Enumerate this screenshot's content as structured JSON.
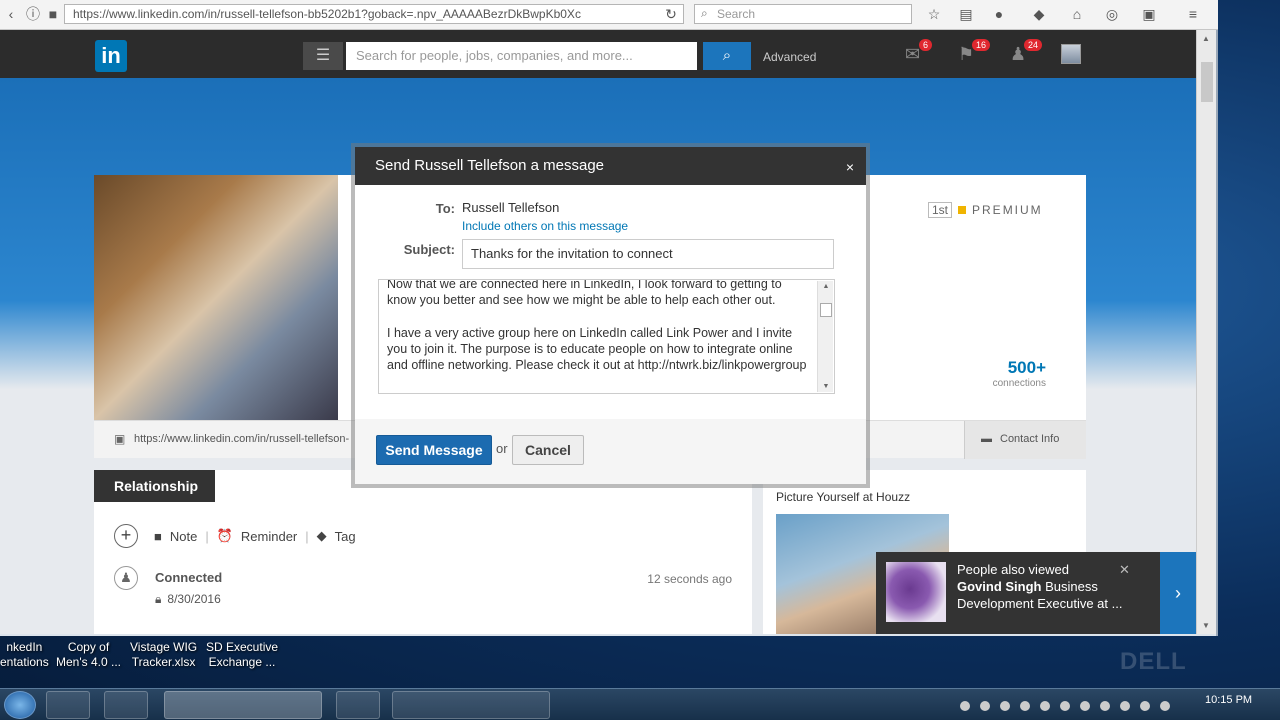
{
  "browser": {
    "url": "https://www.linkedin.com/in/russell-tellefson-bb5202b1?goback=.npv_AAAAABezrDkBwpKb0Xc",
    "search_placeholder": "Search"
  },
  "linkedin_header": {
    "logo": "in",
    "search_placeholder": "Search for people, jobs, companies, and more...",
    "advanced_label": "Advanced",
    "messages_count": "6",
    "notifications_count": "16",
    "add_connections_count": "24"
  },
  "profile": {
    "premium_degree": "1st",
    "premium_label": "PREMIUM",
    "connections_count": "500+",
    "connections_label": "connections",
    "public_url": "https://www.linkedin.com/in/russell-tellefson-",
    "contact_info_label": "Contact Info"
  },
  "relationship": {
    "tab_label": "Relationship",
    "note_label": "Note",
    "reminder_label": "Reminder",
    "tag_label": "Tag",
    "connected_label": "Connected",
    "connected_date": "8/30/2016",
    "connected_time": "12 seconds ago"
  },
  "ad": {
    "title": "Picture Yourself at Houzz"
  },
  "toast": {
    "header": "People also viewed",
    "name": "Govind Singh",
    "headline": "Business Development Executive at ..."
  },
  "modal": {
    "title": "Send Russell Tellefson a message",
    "close_glyph": "×",
    "to_label": "To:",
    "to_name": "Russell Tellefson",
    "include_link": "Include others on this message",
    "subject_label": "Subject:",
    "subject_value": "Thanks for the invitation to connect",
    "body_paragraph_1": "Now that we are connected here in LinkedIn, I look forward to getting to know you better and see how we might be able to help each other out.",
    "body_paragraph_2": "I have a very active group here on LinkedIn called Link Power and I invite you to join it. The purpose is to educate people on how to integrate online and offline networking. Please check it out at http://ntwrk.biz/linkpowergroup",
    "send_label": "Send Message",
    "or_label": "or",
    "cancel_label": "Cancel"
  },
  "desktop": {
    "icons": [
      {
        "line1": "nkedIn",
        "line2": "entations"
      },
      {
        "line1": "Copy of",
        "line2": "Men's 4.0 ..."
      },
      {
        "line1": "Vistage WIG",
        "line2": "Tracker.xlsx"
      },
      {
        "line1": "SD Executive",
        "line2": "Exchange ..."
      }
    ],
    "watermark": "DELL",
    "clock": "10:15 PM"
  }
}
